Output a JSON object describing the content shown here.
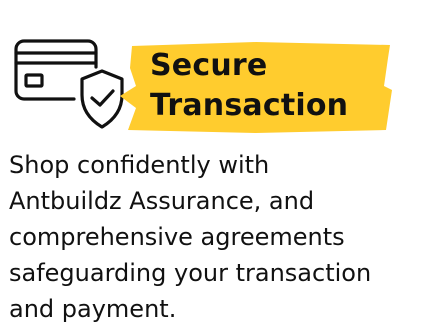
{
  "feature": {
    "icon": "credit-card-shield-check-icon",
    "highlight_color": "#FFCC2E",
    "title_lines": [
      "Secure",
      "Transaction"
    ],
    "description_lines": [
      "Shop confidently with",
      "Antbuildz Assurance, and",
      "comprehensive agreements",
      "safeguarding your transaction",
      "and payment."
    ]
  }
}
